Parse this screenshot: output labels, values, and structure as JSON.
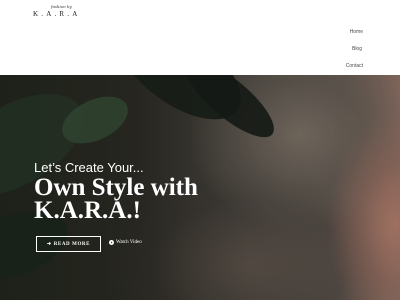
{
  "header": {
    "logo_script": "fashion by",
    "logo_word": "K.A.R.A"
  },
  "nav": {
    "items": [
      {
        "label": "Home"
      },
      {
        "label": "Blog"
      },
      {
        "label": "Contact"
      }
    ]
  },
  "hero": {
    "subtitle": "Let’s Create Your...",
    "title_line1": "Own Style with",
    "title_line2": "K.A.R.A.!",
    "read_more_label": "READ MORE",
    "read_more_icon": "arrow-right-icon",
    "watch_video_label": "Watch Video",
    "watch_video_icon": "play-circle-icon"
  },
  "colors": {
    "header_bg": "#ffffff",
    "nav_text": "#4a4a4a",
    "hero_text": "#ffffff"
  }
}
